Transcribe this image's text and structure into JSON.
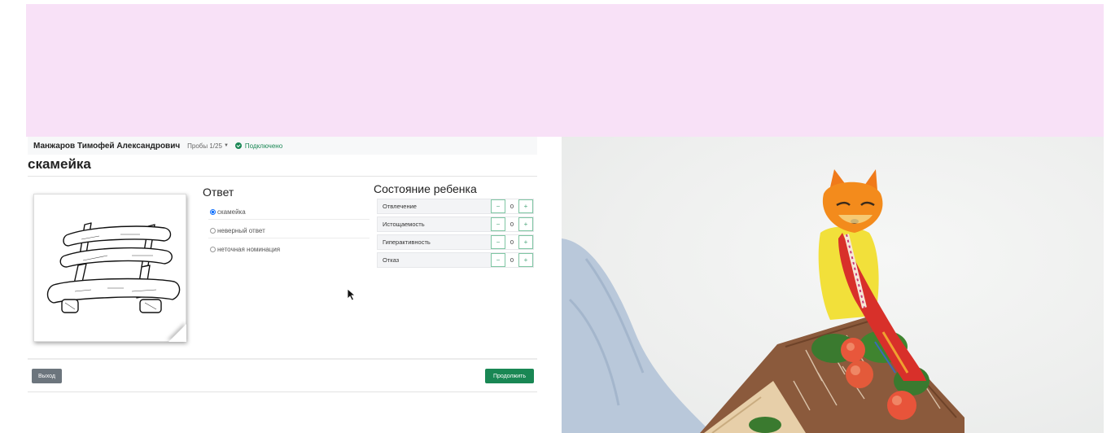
{
  "header": {
    "student_name": "Манжаров Тимофей Александрович",
    "probes": "Пробы 1/25",
    "connection_status": "Подключено"
  },
  "task": {
    "word": "скамейка"
  },
  "answer": {
    "title": "Ответ",
    "options": [
      {
        "label": "скамейка",
        "selected": true
      },
      {
        "label": "неверный ответ",
        "selected": false
      },
      {
        "label": "неточная номинация",
        "selected": false
      }
    ]
  },
  "state": {
    "title": "Состояние ребенка",
    "rows": [
      {
        "label": "Отвлечение",
        "value": "0"
      },
      {
        "label": "Истощаемость",
        "value": "0"
      },
      {
        "label": "Гиперактивность",
        "value": "0"
      },
      {
        "label": "Отказ",
        "value": "0"
      }
    ],
    "minus_symbol": "−",
    "plus_symbol": "+"
  },
  "footer": {
    "exit_label": "Выход",
    "continue_label": "Продолжить"
  },
  "colors": {
    "banner": "#f8e1f7",
    "success": "#198754",
    "secondary": "#6c757d",
    "primary": "#0d6efd"
  },
  "icons": {
    "connection": "check-circle-icon",
    "dropdown": "caret-down-icon",
    "cursor": "mouse-pointer-icon"
  }
}
